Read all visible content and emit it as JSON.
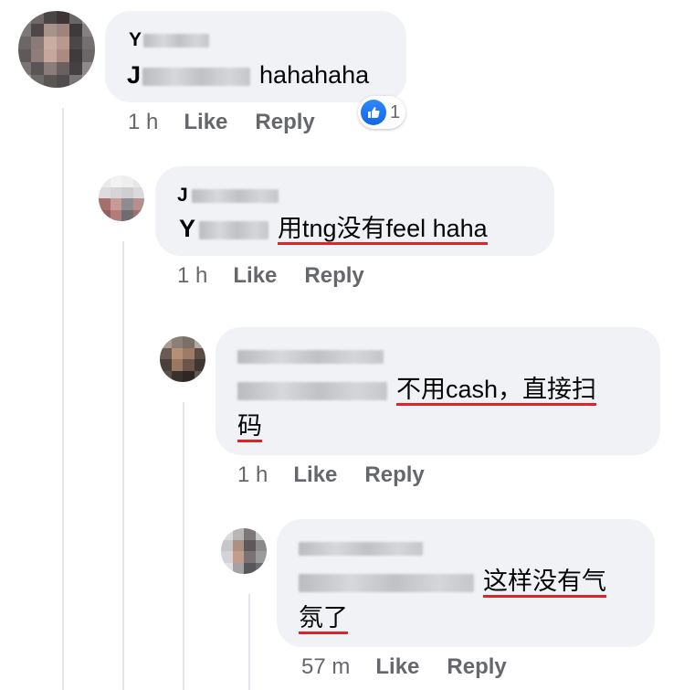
{
  "comments": [
    {
      "author": "Y",
      "name_rest_hidden": "",
      "text_prefix": "J",
      "text": "hahahaha",
      "time": "1 h",
      "like_label": "Like",
      "reply_label": "Reply",
      "reactions": {
        "icon": "thumbs-up-icon",
        "count": "1"
      }
    },
    {
      "author": "J",
      "text_prefix": "Y",
      "text": "用tng没有feel haha",
      "time": "1 h",
      "like_label": "Like",
      "reply_label": "Reply"
    },
    {
      "author": "",
      "text": "不用cash，直接扫",
      "text_line2": "码",
      "time": "1 h",
      "like_label": "Like",
      "reply_label": "Reply"
    },
    {
      "author": "",
      "text": "这样没有气",
      "text_line2": "氛了",
      "time": "57 m",
      "like_label": "Like",
      "reply_label": "Reply"
    }
  ],
  "colors": {
    "bubble": "#f0f2f5",
    "underline": "#e4202a",
    "meta": "#65676b",
    "like_blue": "#1877f2"
  }
}
